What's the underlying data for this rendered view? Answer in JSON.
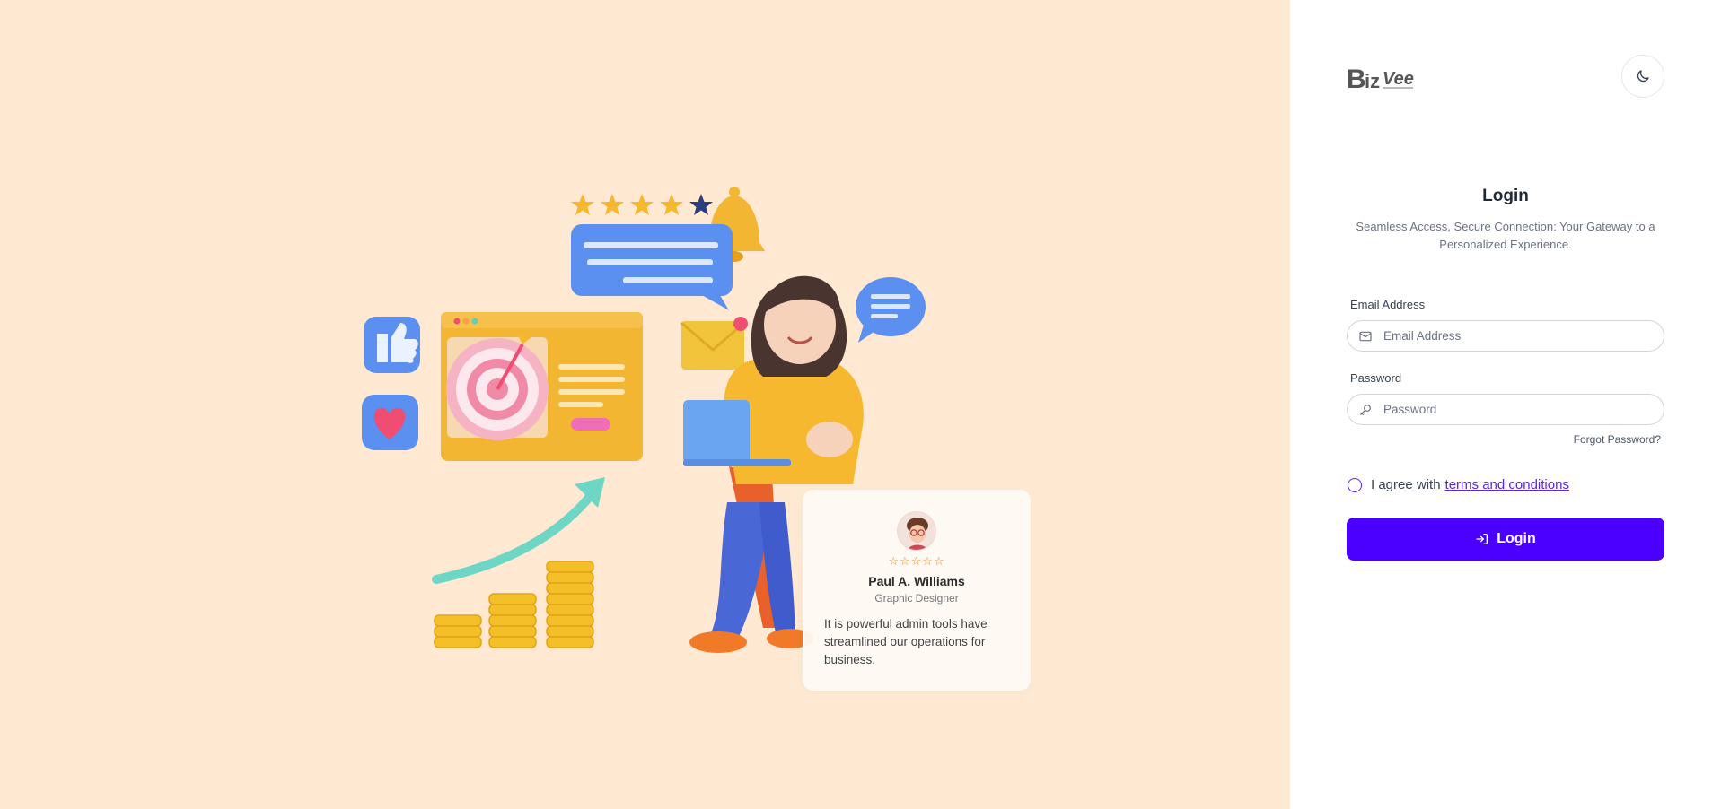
{
  "brand": {
    "logo_text": "BizVee",
    "logo_color": "#555555"
  },
  "theme_toggle": {
    "icon": "moon-icon"
  },
  "login": {
    "title": "Login",
    "subtitle": "Seamless Access, Secure Connection: Your Gateway to a Personalized Experience.",
    "email_label": "Email Address",
    "email_placeholder": "Email Address",
    "email_value": "",
    "password_label": "Password",
    "password_placeholder": "Password",
    "password_value": "",
    "forgot_link": "Forgot Password?",
    "agree_prefix": "I agree with",
    "agree_link": "terms and conditions",
    "agree_checked": false,
    "button_label": "Login",
    "button_icon": "login-icon"
  },
  "testimonial": {
    "stars": "☆☆☆☆☆",
    "rating": 0,
    "name": "Paul A. Williams",
    "role": "Graphic Designer",
    "quote": "It is powerful admin tools have streamlined our operations for business."
  },
  "colors": {
    "left_bg": "#ffe9d2",
    "accent": "#4b00ff",
    "link": "#5b21f5",
    "star_outline": "#f08a24"
  }
}
